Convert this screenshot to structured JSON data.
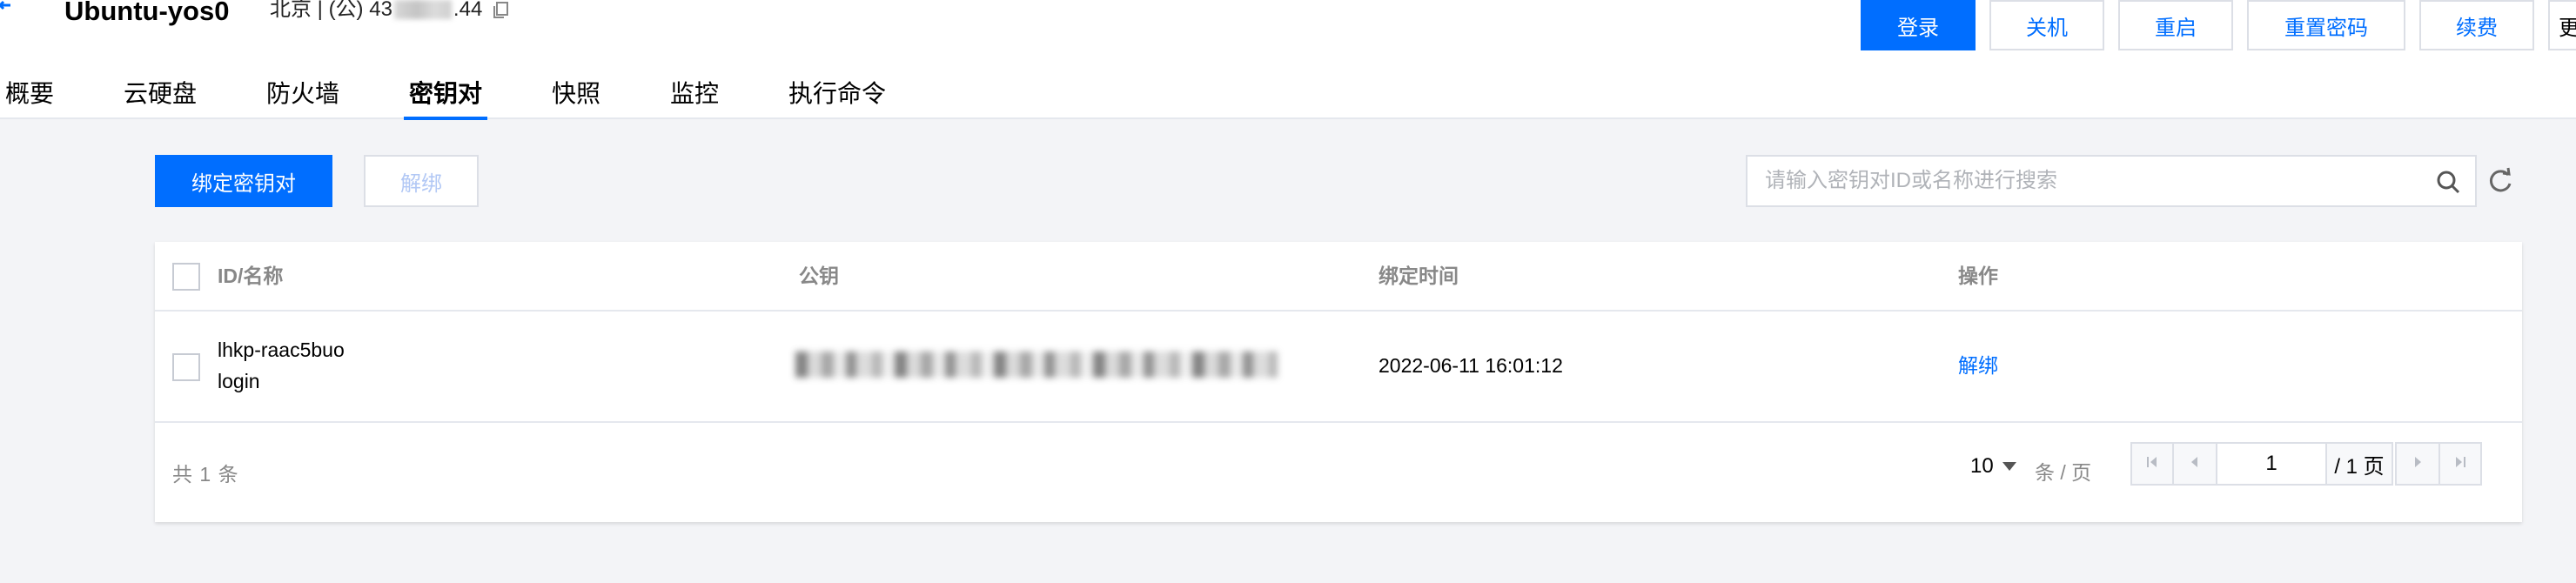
{
  "header": {
    "instance_name": "Ubuntu-yos0",
    "meta_prefix": "北京 | (公) 43",
    "meta_suffix": ".44",
    "buttons": {
      "login": "登录",
      "shutdown": "关机",
      "restart": "重启",
      "reset_password": "重置密码",
      "renew": "续费",
      "more": "更"
    }
  },
  "tabs": [
    {
      "label": "概要"
    },
    {
      "label": "云硬盘"
    },
    {
      "label": "防火墙"
    },
    {
      "label": "密钥对",
      "active": true
    },
    {
      "label": "快照"
    },
    {
      "label": "监控"
    },
    {
      "label": "执行命令"
    }
  ],
  "toolbar": {
    "bind_label": "绑定密钥对",
    "unbind_label": "解绑",
    "search_placeholder": "请输入密钥对ID或名称进行搜索"
  },
  "table": {
    "columns": [
      "ID/名称",
      "公钥",
      "绑定时间",
      "操作"
    ],
    "rows": [
      {
        "id": "lhkp-raac5buo",
        "name": "login",
        "bind_time": "2022-06-11 16:01:12",
        "action": "解绑"
      }
    ]
  },
  "pagination": {
    "total_text": "共 1 条",
    "page_size": "10",
    "per_page_label": "条 / 页",
    "current_page": "1",
    "total_pages_text": "/ 1 页"
  },
  "colors": {
    "accent": "#006eff",
    "background": "#f3f4f7",
    "muted_text": "#888888"
  },
  "icons": [
    "back-icon",
    "copy-icon",
    "search-icon",
    "refresh-icon",
    "first-page-icon",
    "prev-page-icon",
    "next-page-icon",
    "last-page-icon"
  ]
}
